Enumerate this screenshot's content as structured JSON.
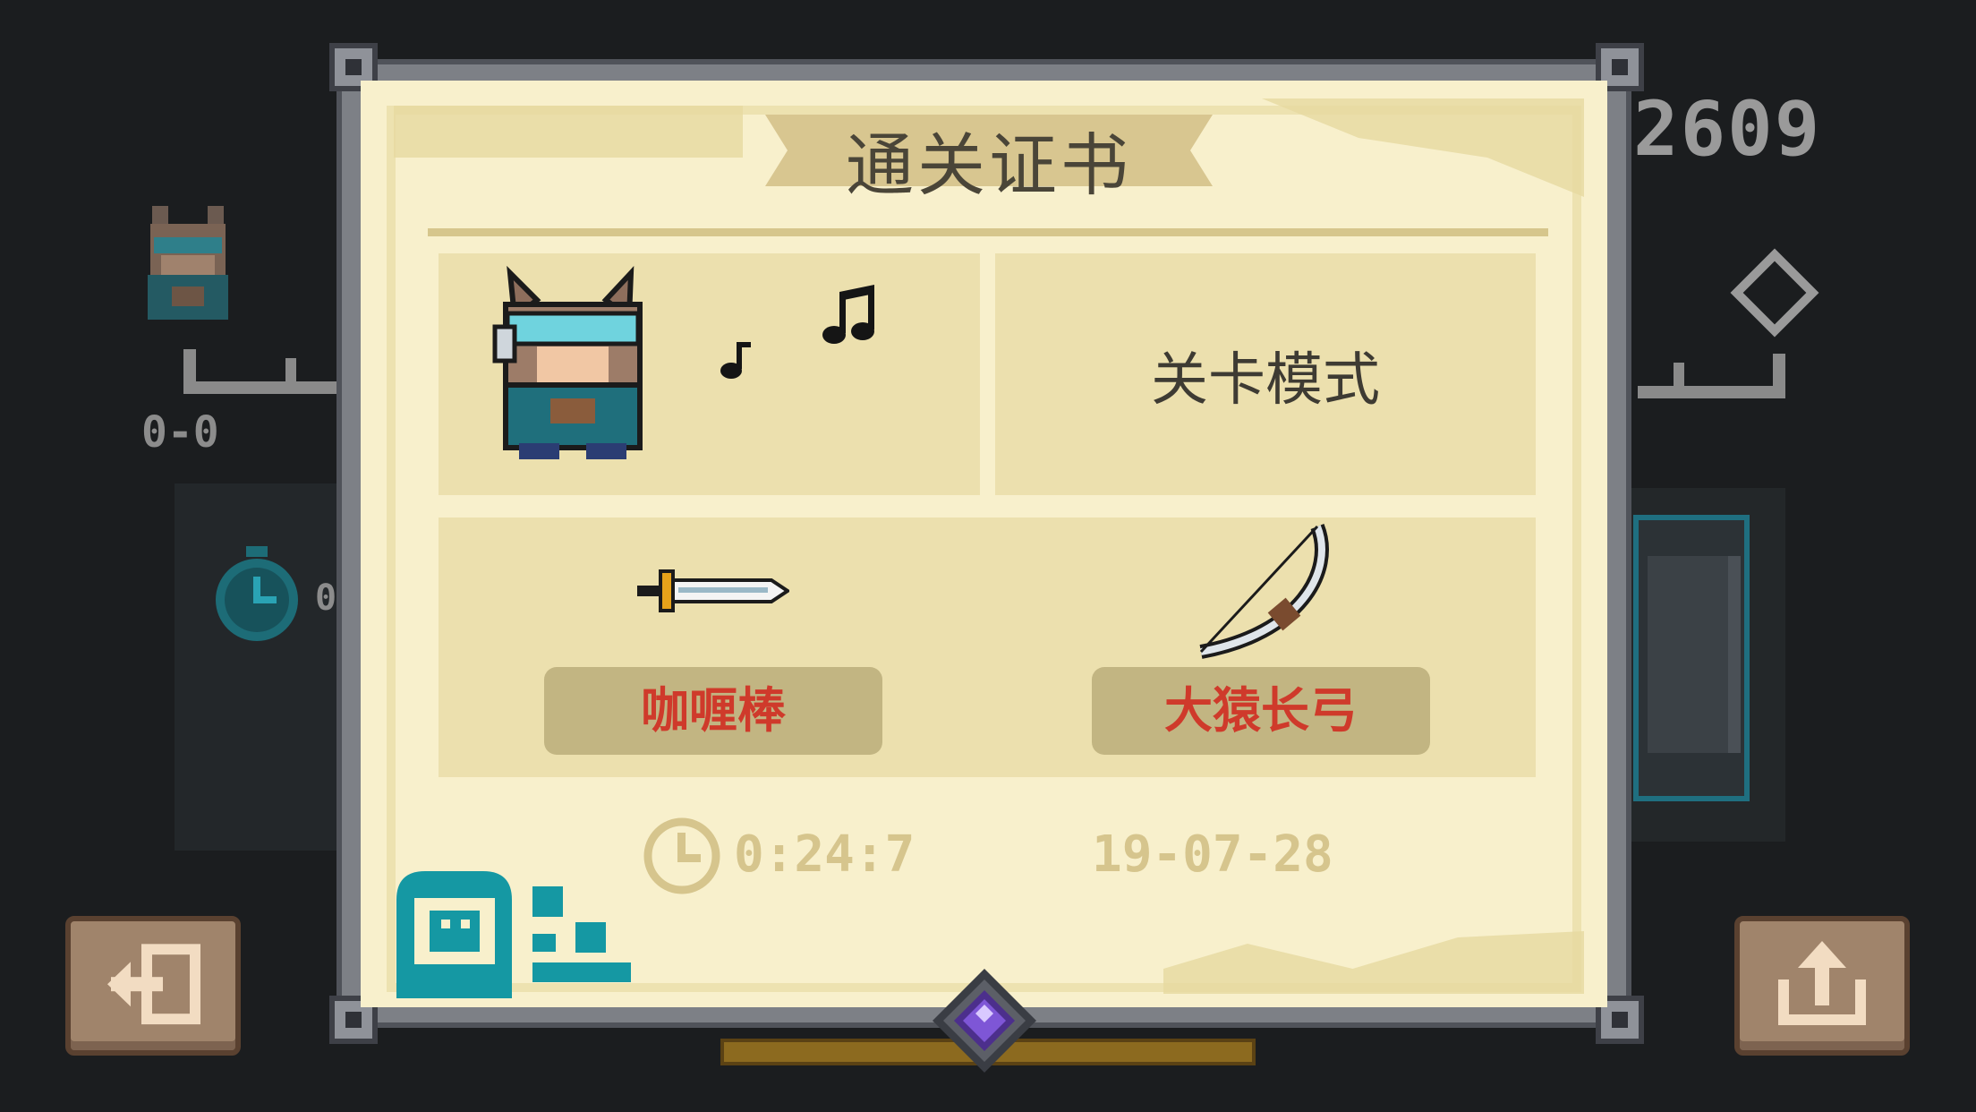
{
  "background": {
    "score": "2609",
    "level": "0-0",
    "stat_partial": "0"
  },
  "certificate": {
    "title": "通关证书",
    "mode": "关卡模式",
    "weapons": [
      {
        "name": "咖喱棒",
        "icon": "sword-icon"
      },
      {
        "name": "大猿长弓",
        "icon": "bow-icon"
      }
    ],
    "time": "0:24:7",
    "date": "19-07-28"
  },
  "buttons": {
    "exit_icon": "exit-icon",
    "share_icon": "share-icon"
  },
  "colors": {
    "paper": "#f8f0cc",
    "weapon_name": "#cf3a2b",
    "frame": "#7d8086"
  }
}
